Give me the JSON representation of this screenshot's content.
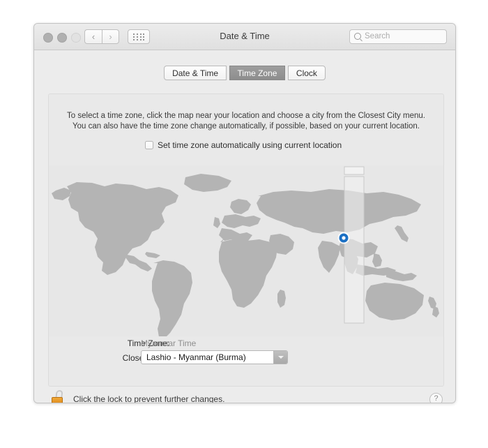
{
  "window": {
    "title": "Date & Time",
    "controls": {
      "close": "close",
      "minimize": "minimize",
      "zoom": "zoom"
    },
    "nav": {
      "back": "‹",
      "forward": "›"
    },
    "show_all": "show-all-preferences"
  },
  "search": {
    "placeholder": "Search",
    "value": ""
  },
  "tabs": [
    {
      "label": "Date & Time",
      "active": false
    },
    {
      "label": "Time Zone",
      "active": true
    },
    {
      "label": "Clock",
      "active": false
    }
  ],
  "instructions": {
    "line1": "To select a time zone, click the map near your location and choose a city from the Closest City menu.",
    "line2": "You can also have the time zone change automatically, if possible, based on your current location."
  },
  "auto_timezone": {
    "label": "Set time zone automatically using current location",
    "checked": false
  },
  "map": {
    "marker_label": "current-location-marker",
    "land_color": "#b4b4b4",
    "water_color": "#e4e4e4",
    "band_color": "#eeeeee",
    "marker_color": "#1a6fc4"
  },
  "fields": {
    "time_zone_label": "Time Zone:",
    "time_zone_value": "Myanmar Time",
    "closest_city_label": "Closest City:",
    "closest_city_value": "Lashio - Myanmar (Burma)"
  },
  "footer": {
    "lock_text": "Click the lock to prevent further changes.",
    "lock_state": "unlocked",
    "help_label": "?"
  }
}
